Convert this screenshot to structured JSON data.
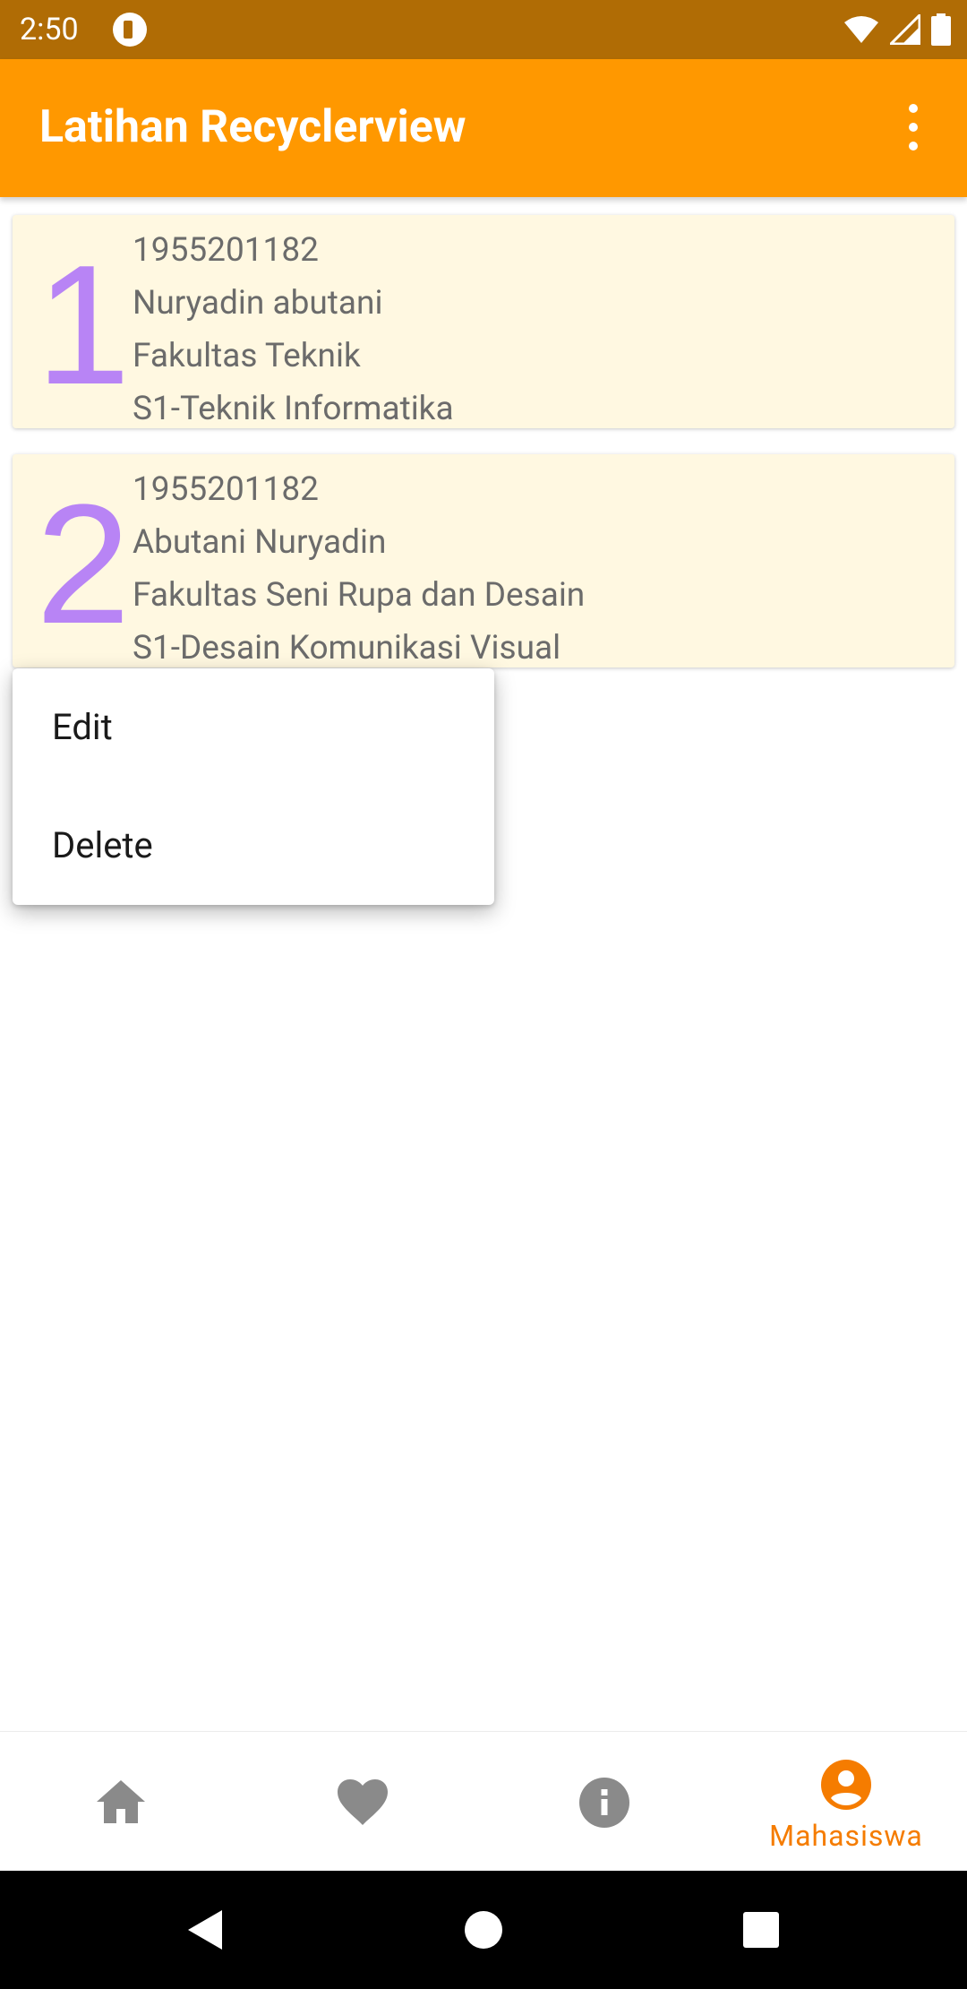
{
  "status_bar": {
    "time": "2:50",
    "icons": [
      "app-notification-icon",
      "wifi-icon",
      "signal-icon",
      "battery-icon"
    ]
  },
  "app_bar": {
    "title": "Latihan Recyclerview",
    "overflow_icon": "more-vert-icon"
  },
  "students": [
    {
      "number": "1",
      "nim": "1955201182",
      "name": "Nuryadin abutani",
      "faculty": "Fakultas Teknik",
      "program": "S1-Teknik Informatika"
    },
    {
      "number": "2",
      "nim": "1955201182",
      "name": "Abutani Nuryadin",
      "faculty": "Fakultas Seni Rupa dan Desain",
      "program": "S1-Desain Komunikasi Visual"
    }
  ],
  "popup_menu": {
    "items": [
      {
        "label": "Edit"
      },
      {
        "label": "Delete"
      }
    ]
  },
  "bottom_nav": {
    "items": [
      {
        "icon": "home-icon",
        "label": ""
      },
      {
        "icon": "heart-icon",
        "label": ""
      },
      {
        "icon": "info-icon",
        "label": ""
      },
      {
        "icon": "account-icon",
        "label": "Mahasiswa",
        "selected": true
      }
    ],
    "active_color": "#F57C00",
    "inactive_color": "#8a8a8a"
  },
  "colors": {
    "status_bar": "#B06C05",
    "app_bar": "#FF9800",
    "card_background": "#FFF8E1",
    "card_number": "#B884F5"
  }
}
